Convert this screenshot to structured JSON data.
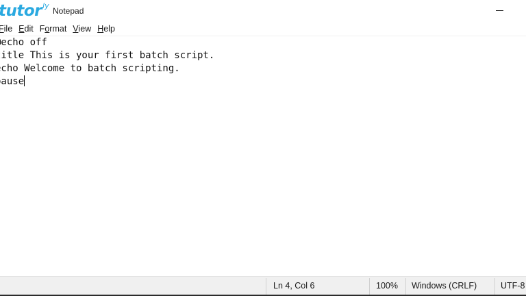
{
  "logo": {
    "main": "tutor",
    "sup": "ly"
  },
  "window": {
    "title": "Notepad",
    "minimize_icon": "minimize-icon"
  },
  "menu": [
    {
      "label_first": "F",
      "label_rest": "ile",
      "accel": "F"
    },
    {
      "label_first": "E",
      "label_rest": "dit",
      "accel": "E"
    },
    {
      "label_first": "F",
      "label_rest": "ormat",
      "accel": "O"
    },
    {
      "label_first": "V",
      "label_rest": "iew",
      "accel": "V"
    },
    {
      "label_first": "H",
      "label_rest": "elp",
      "accel": "H"
    }
  ],
  "menu_text": {
    "file_a": "F",
    "file_b": "ile",
    "edit_a": "E",
    "edit_b": "dit",
    "format_a": "F",
    "format_b": "o",
    "format_c": "rmat",
    "view_a": "V",
    "view_b": "iew",
    "help_a": "H",
    "help_b": "elp"
  },
  "editor": {
    "lines": [
      "@echo off",
      "title This is your first batch script.",
      "echo Welcome to batch scripting.",
      "pause"
    ]
  },
  "status": {
    "position": "Ln 4, Col 6",
    "zoom": "100%",
    "line_ending": "Windows (CRLF)",
    "encoding": "UTF-8"
  },
  "colors": {
    "logo": "#2aa9e0",
    "statusbar": "#f0f0f0",
    "text": "#111111"
  }
}
